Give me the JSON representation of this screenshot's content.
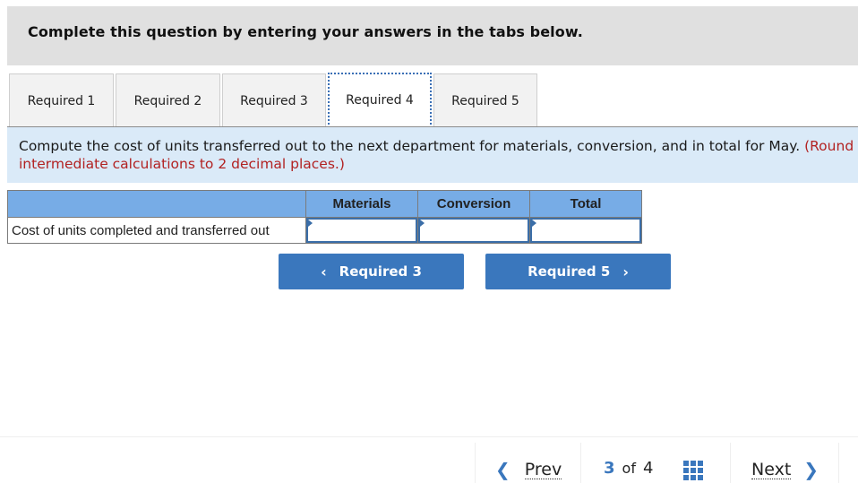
{
  "instruction": "Complete this question by entering your answers in the tabs below.",
  "tabs": [
    {
      "label": "Required 1",
      "active": false
    },
    {
      "label": "Required 2",
      "active": false
    },
    {
      "label": "Required 3",
      "active": false
    },
    {
      "label": "Required 4",
      "active": true
    },
    {
      "label": "Required 5",
      "active": false
    }
  ],
  "prompt": {
    "line1_main": "Compute the cost of units transferred out to the next department for materials, conversion, and in total for May.",
    "line1_red": "(Round",
    "line2": "intermediate calculations to 2 decimal places.)"
  },
  "table": {
    "headers": [
      "",
      "Materials",
      "Conversion",
      "Total"
    ],
    "rows": [
      {
        "label": "Cost of units completed and transferred out",
        "values": [
          "",
          "",
          ""
        ]
      }
    ]
  },
  "nav_buttons": {
    "prev_label": "Required 3",
    "next_label": "Required 5",
    "prev_icon": "‹",
    "next_icon": "›"
  },
  "pager": {
    "prev_label": "Prev",
    "next_label": "Next",
    "current": "3",
    "of_label": "of",
    "total": "4",
    "prev_icon": "❮",
    "next_icon": "❯"
  },
  "colors": {
    "accent": "#3a77bd",
    "table_header": "#77ace6",
    "prompt_bg": "#daeaf8",
    "instruction_bg": "#e0e0e0",
    "red_text": "#b22222"
  }
}
